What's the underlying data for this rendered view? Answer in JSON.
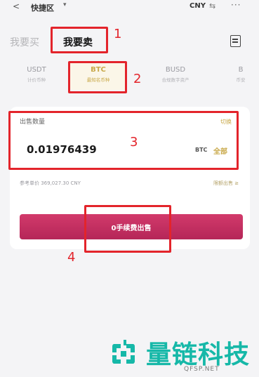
{
  "topbar": {
    "back_icon": "chevron-left",
    "title": "快捷区",
    "caret": "▾",
    "currency": "CNY",
    "swap_icon": "swap-arrows",
    "more_icon": "ellipsis"
  },
  "trade_tabs": {
    "buy": "我要买",
    "sell": "我要卖"
  },
  "coins": [
    {
      "symbol": "USDT",
      "desc": "计价币种"
    },
    {
      "symbol": "BTC",
      "desc": "最知名币种"
    },
    {
      "symbol": "BUSD",
      "desc": "合规数字资产"
    },
    {
      "symbol": "B",
      "desc": "币安"
    }
  ],
  "sell_form": {
    "quantity_label": "出售数量",
    "quantity_hint": "切换",
    "amount": "0.01976439",
    "amount_currency": "BTC",
    "all_label": "全部",
    "reference_price": "参考单价 369,027.30 CNY",
    "right_note": "限额出售 ≥",
    "sell_button": "0手续费出售"
  },
  "annotations": [
    "1",
    "2",
    "3",
    "4"
  ],
  "watermark": {
    "brand": "量链科技",
    "domain": "QFSP.NET"
  },
  "colors": {
    "gold": "#c9a94a",
    "sell_red": "#c12e60",
    "annotation_red": "#e3242b",
    "watermark_teal": "#16b8a8"
  }
}
